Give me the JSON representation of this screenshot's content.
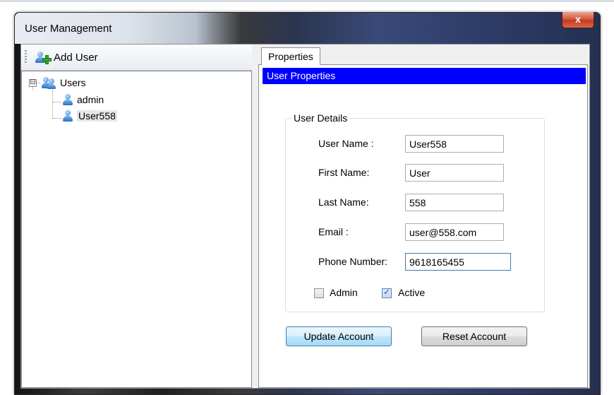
{
  "window": {
    "title": "User Management",
    "close_label": "x"
  },
  "toolbar": {
    "add_user_label": "Add User"
  },
  "tree": {
    "root": {
      "label": "Users",
      "expanded": true,
      "expander": "⊟"
    },
    "children": [
      {
        "label": "admin",
        "selected": false
      },
      {
        "label": "User558",
        "selected": true
      }
    ]
  },
  "tabs": [
    {
      "label": "Properties",
      "active": true
    }
  ],
  "properties": {
    "header": "User Properties",
    "group_title": "User Details",
    "fields": [
      {
        "label": "User Name :",
        "value": "User558"
      },
      {
        "label": "First Name:",
        "value": "User"
      },
      {
        "label": "Last Name:",
        "value": "558"
      },
      {
        "label": "Email :",
        "value": "user@558.com"
      },
      {
        "label": "Phone Number:",
        "value": "9618165455"
      }
    ],
    "checkboxes": [
      {
        "label": "Admin",
        "checked": false
      },
      {
        "label": "Active",
        "checked": true
      }
    ],
    "buttons": {
      "update": "Update Account",
      "reset": "Reset Account"
    }
  },
  "colors": {
    "header_bg": "#0000ff",
    "header_text": "#ffffff",
    "close_button": "#c23a1c"
  },
  "icons": {
    "add_user": "add-user-icon",
    "users_group": "users-group-icon",
    "user": "user-icon",
    "checkmark": "✓"
  }
}
